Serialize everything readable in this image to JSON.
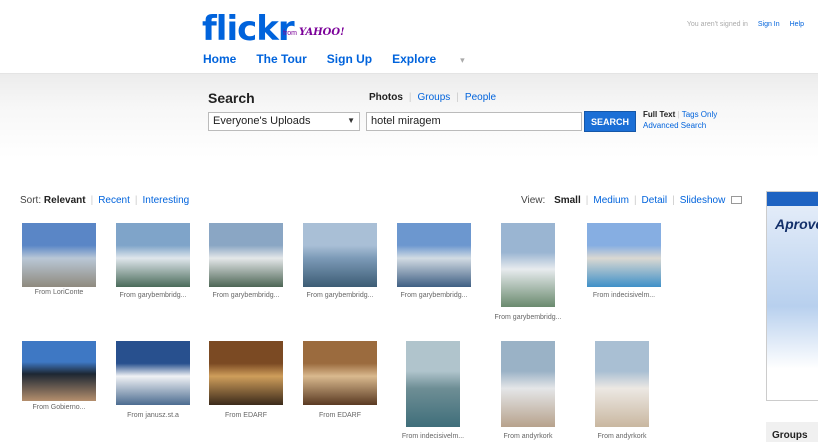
{
  "header": {
    "logo_text": "flickr",
    "logo_dot": "r",
    "yahoo_from": "from",
    "yahoo_brand": "YAHOO!",
    "signed_status": "You aren't signed in",
    "sign_in": "Sign In",
    "help": "Help",
    "nav": [
      "Home",
      "The Tour",
      "Sign Up",
      "Explore"
    ]
  },
  "search": {
    "title": "Search",
    "tab_photos": "Photos",
    "tab_groups": "Groups",
    "tab_people": "People",
    "scope_value": "Everyone's Uploads",
    "query_value": "hotel miragem",
    "button_label": "SEARCH",
    "full_text": "Full Text",
    "tags_only": "Tags Only",
    "advanced": "Advanced Search"
  },
  "sort": {
    "label": "Sort:",
    "relevant": "Relevant",
    "recent": "Recent",
    "interesting": "Interesting"
  },
  "view": {
    "label": "View:",
    "small": "Small",
    "medium": "Medium",
    "detail": "Detail",
    "slideshow": "Slideshow"
  },
  "ad": {
    "text": "Aprove"
  },
  "sidebar": {
    "groups": "Groups"
  },
  "photos": [
    {
      "caption": "From LoriConte",
      "colors": [
        "#5a86c6",
        "#b9c7d6",
        "#8f8a7e"
      ]
    },
    {
      "caption": "From garybembridg...",
      "colors": [
        "#7fa4c9",
        "#dfe6ec",
        "#4a6b5a"
      ]
    },
    {
      "caption": "From garybembridg...",
      "colors": [
        "#8aa6c4",
        "#e4e7e9",
        "#4d6655"
      ]
    },
    {
      "caption": "From garybembridg...",
      "colors": [
        "#a9bfd6",
        "#7c9ab7",
        "#3c5c74"
      ]
    },
    {
      "caption": "From garybembridg...",
      "colors": [
        "#6c97cf",
        "#d2dbe3",
        "#3f5f83"
      ]
    },
    {
      "caption": "From garybembridg...",
      "colors": [
        "#9ab5d2",
        "#e7ebee",
        "#6a8a6e"
      ]
    },
    {
      "caption": "From indecisivelm...",
      "colors": [
        "#86aee2",
        "#dad8d2",
        "#3f90c8"
      ]
    },
    {
      "caption": "From Gobierno...",
      "colors": [
        "#3e78c4",
        "#1d2733",
        "#b58f6d"
      ]
    },
    {
      "caption": "From janusz.st.a",
      "colors": [
        "#28508e",
        "#f0f2f5",
        "#4c6c90"
      ]
    },
    {
      "caption": "From EDARF",
      "colors": [
        "#7b4a23",
        "#cf9e5b",
        "#3b2a1a"
      ]
    },
    {
      "caption": "From EDARF",
      "colors": [
        "#9b6b3e",
        "#d9b98e",
        "#5a3a22"
      ]
    },
    {
      "caption": "From indecisivelm...",
      "colors": [
        "#b0c4cc",
        "#6e8e95",
        "#3f6e7a"
      ]
    },
    {
      "caption": "From andyrkork",
      "colors": [
        "#9ab2c6",
        "#e4e6e8",
        "#b7a28c"
      ]
    },
    {
      "caption": "From andyrkork",
      "colors": [
        "#a9bfd3",
        "#ece8e3",
        "#c9b7a0"
      ]
    }
  ]
}
